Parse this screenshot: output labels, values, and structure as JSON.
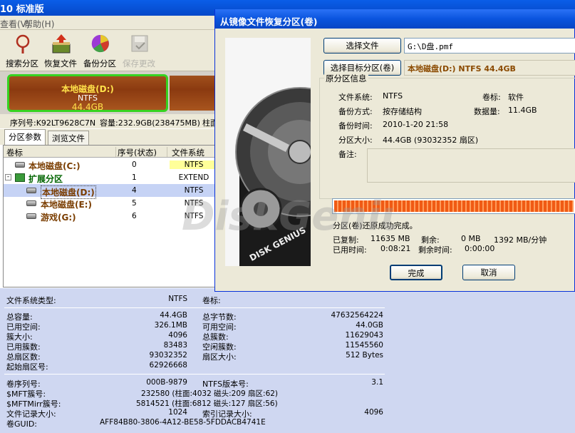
{
  "main_window": {
    "title": "10 标准版",
    "menu": [
      "查看(V)",
      "帮助(H)"
    ],
    "toolbar": [
      {
        "label": "搜索分区",
        "icon": "search-partition-icon"
      },
      {
        "label": "恢复文件",
        "icon": "recover-files-icon"
      },
      {
        "label": "备份分区",
        "icon": "backup-partition-icon"
      },
      {
        "label": "保存更改",
        "icon": "save-changes-icon"
      }
    ],
    "disk_bar": {
      "name": "本地磁盘(D:)",
      "fs": "NTFS",
      "size": "44.4GB"
    },
    "disk_info": {
      "serial": "序列号:K92LT9628C7N",
      "capacity": "容量:232.9GB(238475MB)",
      "cyl": "柱面"
    },
    "tabs": [
      "分区参数",
      "浏览文件"
    ],
    "tree": {
      "columns": [
        "卷标",
        "序号(状态)",
        "文件系统"
      ],
      "rows": [
        {
          "name": "本地磁盘(C:)",
          "index": "0",
          "fs": "NTFS"
        },
        {
          "name": "扩展分区",
          "index": "1",
          "fs": "EXTEND"
        },
        {
          "name": "本地磁盘(D:)",
          "index": "4",
          "fs": "NTFS"
        },
        {
          "name": "本地磁盘(E:)",
          "index": "5",
          "fs": "NTFS"
        },
        {
          "name": "游戏(G:)",
          "index": "6",
          "fs": "NTFS"
        }
      ]
    },
    "props": {
      "fs_type_label": "文件系统类型:",
      "fs_type": "NTFS",
      "vol_label": "卷标:",
      "left": [
        [
          "总容量:",
          "44.4GB"
        ],
        [
          "已用空间:",
          "326.1MB"
        ],
        [
          "簇大小:",
          "4096"
        ],
        [
          "已用簇数:",
          "83483"
        ],
        [
          "总扇区数:",
          "93032352"
        ],
        [
          "起始扇区号:",
          "62926668"
        ]
      ],
      "right": [
        [
          "总字节数:",
          "47632564224"
        ],
        [
          "可用空间:",
          "44.0GB"
        ],
        [
          "总簇数:",
          "11629043"
        ],
        [
          "空闲簇数:",
          "11545560"
        ],
        [
          "扇区大小:",
          "512 Bytes"
        ]
      ],
      "serial_label": "卷序列号:",
      "serial": "000B-9879",
      "ntfs_ver_label": "NTFS版本号:",
      "ntfs_ver": "3.1",
      "mft_label": "$MFT簇号:",
      "mft": "232580 (柱面:4032 磁头:209 扇区:62)",
      "mftmirr_label": "$MFTMirr簇号:",
      "mftmirr": "5814521 (柱面:6812 磁头:127 扇区:56)",
      "record_label": "文件记录大小:",
      "record": "1024",
      "index_label": "索引记录大小:",
      "index": "4096",
      "guid_label": "卷GUID:",
      "guid": "AFF84B80-3806-4A12-BE58-5FDDACB4741E"
    }
  },
  "dialog": {
    "title": "从镜像文件恢复分区(卷)",
    "select_file_btn": "选择文件",
    "file_path": "G:\\D盘.pmf",
    "select_target_btn": "选择目标分区(卷)",
    "target": "本地磁盘(D:) NTFS 44.4GB",
    "group_title": "原分区信息",
    "info": {
      "fs_label": "文件系统:",
      "fs": "NTFS",
      "vol_label": "卷标:",
      "vol": "软件",
      "mode_label": "备份方式:",
      "mode": "按存储结构",
      "datasize_label": "数据量:",
      "datasize": "11.4GB",
      "time_label": "备份时间:",
      "time": "2010-1-20 21:58",
      "size_label": "分区大小:",
      "size": "44.4GB  (93032352 扇区)",
      "note_label": "备注:"
    },
    "progress": 1.0,
    "status": "分区(卷)还原成功完成。",
    "copied_label": "已复制:",
    "copied": "11635 MB",
    "remain_label": "剩余:",
    "remain": "0 MB",
    "speed": "1392 MB/分钟",
    "elapsed_label": "已用时间:",
    "elapsed": "0:08:21",
    "remain_time_label": "剩余时间:",
    "remain_time": "0:00:00",
    "done_btn": "完成",
    "cancel_btn": "取消",
    "banner_text": "DISK GENIUS"
  },
  "watermark": "DiskGenius",
  "colors": {
    "accent_blue": "#0a54de",
    "highlight": "#ffff99",
    "progress": "#f05a14",
    "disk_green": "#36d321"
  }
}
